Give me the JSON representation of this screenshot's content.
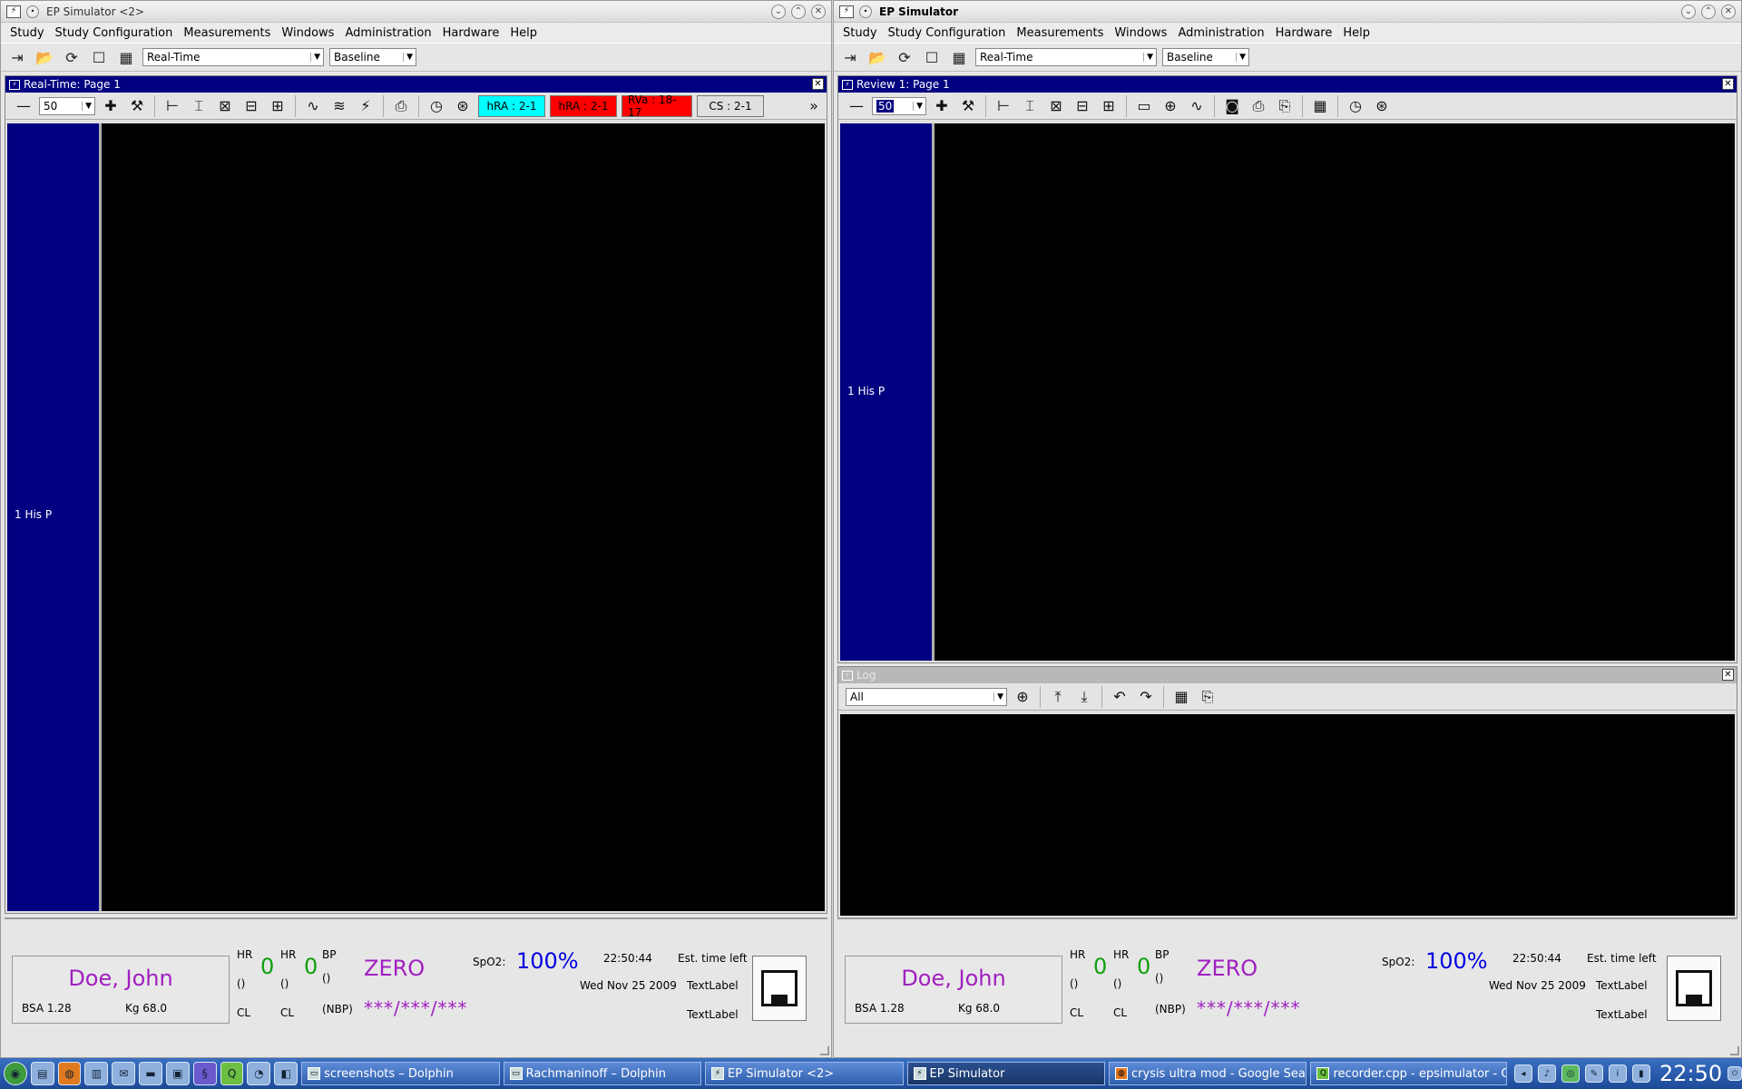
{
  "left_window": {
    "title": "EP Simulator <2>",
    "menu": [
      "Study",
      "Study Configuration",
      "Measurements",
      "Windows",
      "Administration",
      "Hardware",
      "Help"
    ],
    "mode_combo": "Real-Time",
    "baseline_combo": "Baseline",
    "subwindow": {
      "title": "Real-Time: Page 1",
      "zoom_value": "50",
      "badges": [
        {
          "label": "hRA : 2-1",
          "bg": "#00ffff",
          "fg": "#000000"
        },
        {
          "label": "hRA : 2-1",
          "bg": "#ff0000",
          "fg": "#000000"
        },
        {
          "label": "RVa : 18-17",
          "bg": "#ff0000",
          "fg": "#000000"
        },
        {
          "label": "CS : 2-1",
          "bg": "#e0e0e0",
          "fg": "#000000"
        }
      ],
      "more": "»",
      "channel_label": "1 His P"
    },
    "status": {
      "patient_name": "Doe, John",
      "bsa": "BSA 1.28",
      "kg": "Kg 68.0",
      "hr1_label": "HR",
      "hr1_value": "0",
      "hr1_unit": "()",
      "cl1": "CL",
      "hr2_label": "HR",
      "hr2_value": "0",
      "hr2_unit": "()",
      "cl2": "CL",
      "bp_label": "BP",
      "bp_unit": "()",
      "nbp": "(NBP)",
      "bp_value": "ZERO",
      "nbp_value": "***/***/***",
      "spo2_label": "SpO2:",
      "spo2_value": "100%",
      "time": "22:50:44",
      "date": "Wed Nov 25 2009",
      "est_label": "Est. time left",
      "textlabel1": "TextLabel",
      "textlabel2": "TextLabel"
    }
  },
  "right_window": {
    "title": "EP Simulator",
    "menu": [
      "Study",
      "Study Configuration",
      "Measurements",
      "Windows",
      "Administration",
      "Hardware",
      "Help"
    ],
    "mode_combo": "Real-Time",
    "baseline_combo": "Baseline",
    "review": {
      "title": "Review 1: Page 1",
      "zoom_value": "50",
      "channel_label": "1 His P"
    },
    "log": {
      "title": "Log",
      "filter": "All"
    },
    "status": {
      "patient_name": "Doe, John",
      "bsa": "BSA 1.28",
      "kg": "Kg 68.0",
      "hr1_label": "HR",
      "hr1_value": "0",
      "hr1_unit": "()",
      "cl1": "CL",
      "hr2_label": "HR",
      "hr2_value": "0",
      "hr2_unit": "()",
      "cl2": "CL",
      "bp_label": "BP",
      "bp_unit": "()",
      "nbp": "(NBP)",
      "bp_value": "ZERO",
      "nbp_value": "***/***/***",
      "spo2_label": "SpO2:",
      "spo2_value": "100%",
      "time": "22:50:44",
      "date": "Wed Nov 25 2009",
      "est_label": "Est. time left",
      "textlabel1": "TextLabel",
      "textlabel2": "TextLabel"
    }
  },
  "taskbar": {
    "tasks": [
      {
        "label": "screenshots – Dolphin",
        "active": false
      },
      {
        "label": "Rachmaninoff – Dolphin",
        "active": false
      },
      {
        "label": "EP Simulator <2>",
        "active": false
      },
      {
        "label": "EP Simulator",
        "active": true
      },
      {
        "label": "crysis ultra mod - Google Sear",
        "active": false
      },
      {
        "label": "recorder.cpp - epsimulator - Qt",
        "active": false
      }
    ],
    "clock": "22:50"
  }
}
